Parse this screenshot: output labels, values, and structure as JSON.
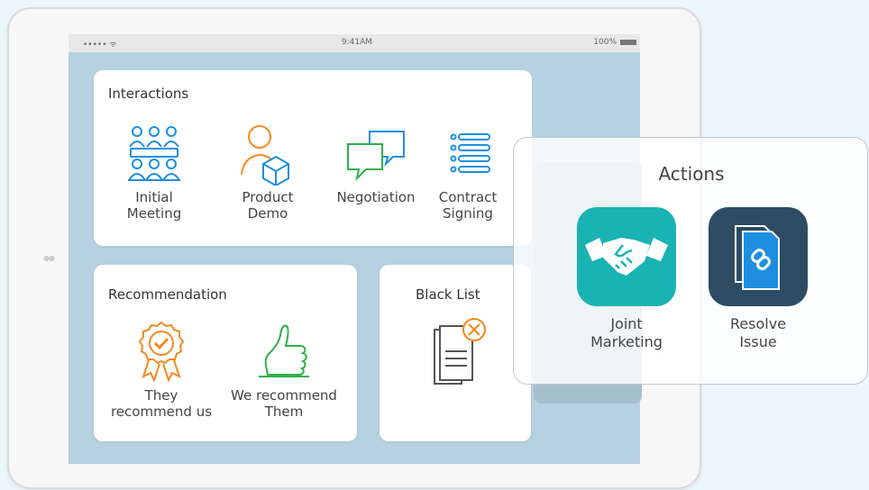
{
  "status_bar": {
    "signal": "••••• ᯤ",
    "time": "9:41AM",
    "battery": "100%"
  },
  "interactions": {
    "title": "Interactions",
    "items": [
      {
        "line1": "Initial",
        "line2": "Meeting",
        "icon": "meeting-icon"
      },
      {
        "line1": "Product",
        "line2": "Demo",
        "icon": "product-demo-icon"
      },
      {
        "line1": "Negotiation",
        "line2": "",
        "icon": "negotiation-icon"
      },
      {
        "line1": "Contract",
        "line2": "Signing",
        "icon": "contract-signing-icon"
      }
    ]
  },
  "recommendation": {
    "title": "Recommendation",
    "items": [
      {
        "line1": "They",
        "line2": "recommend us",
        "icon": "award-icon"
      },
      {
        "line1": "We recommend",
        "line2": "Them",
        "icon": "thumbs-up-icon"
      }
    ]
  },
  "black_list": {
    "title": "Black List",
    "icon": "blacklist-document-icon"
  },
  "actions": {
    "title": "Actions",
    "items": [
      {
        "line1": "Joint",
        "line2": "Marketing",
        "icon": "handshake-icon",
        "color": "#1ab3b3"
      },
      {
        "line1": "Resolve",
        "line2": "Issue",
        "icon": "linked-document-icon",
        "color": "#2d4c63"
      }
    ]
  },
  "colors": {
    "blue": "#1e8fe0",
    "orange": "#f5891f",
    "green": "#2fb04a",
    "teal": "#1ab3b3",
    "navy": "#2d4c63",
    "screen_bg": "#b6d1e0"
  }
}
